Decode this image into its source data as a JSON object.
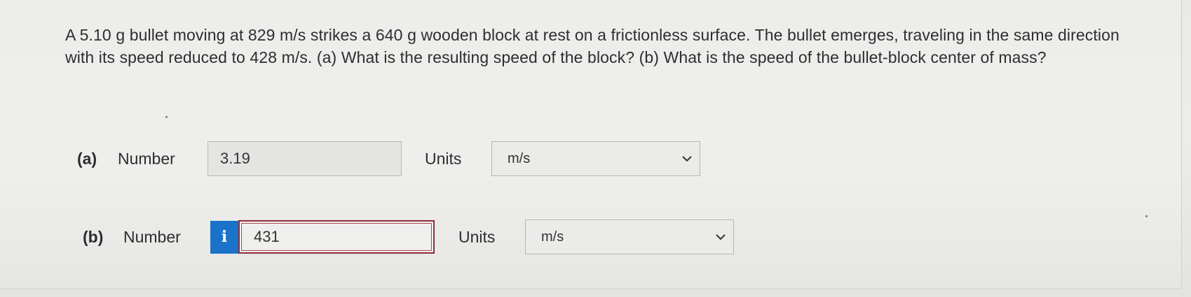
{
  "question": {
    "text": "A 5.10 g bullet moving at 829 m/s strikes a 640 g wooden block at rest on a frictionless surface. The bullet emerges, traveling in the same direction with its speed reduced to 428 m/s. (a) What is the resulting speed of the block? (b) What is the speed of the bullet-block center of mass?"
  },
  "part_a": {
    "label": "(a)",
    "number_label": "Number",
    "value": "3.19",
    "units_label": "Units",
    "unit_selected": "m/s"
  },
  "part_b": {
    "label": "(b)",
    "number_label": "Number",
    "info_glyph": "i",
    "value": "431",
    "units_label": "Units",
    "unit_selected": "m/s"
  },
  "icons": {
    "info": "info-icon",
    "dropdown": "chevron-down-icon"
  },
  "colors": {
    "info_button": "#1a73c9",
    "error_border": "#8c2d36",
    "background": "#ececea"
  }
}
